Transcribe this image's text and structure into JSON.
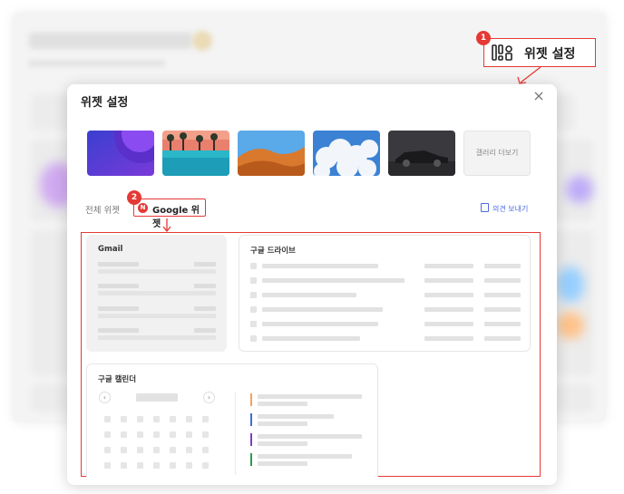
{
  "modal": {
    "title": "위젯 설정",
    "close_icon": "close-icon",
    "gallery_more_label": "갤러리 더보기",
    "tabs": {
      "all_label": "전체 위젯",
      "google_label": "Google 위젯",
      "google_icon_letter": "N"
    },
    "feedback_label": "의견 보내기"
  },
  "widgets": {
    "gmail_title": "Gmail",
    "drive_title": "구글 드라이브",
    "calendar_title": "구글 캘린더",
    "calendar_prev": "‹",
    "calendar_next": "›",
    "event_colors": [
      "#f5a25a",
      "#3b6fe0",
      "#7b3fc2",
      "#2f9a4a"
    ]
  },
  "callouts": {
    "one": {
      "number": "1",
      "label": "위젯 설정",
      "icon": "widget-settings-icon"
    },
    "two": {
      "number": "2"
    }
  },
  "colors": {
    "highlight": "#e53935",
    "accent_link": "#4a6ee0"
  }
}
